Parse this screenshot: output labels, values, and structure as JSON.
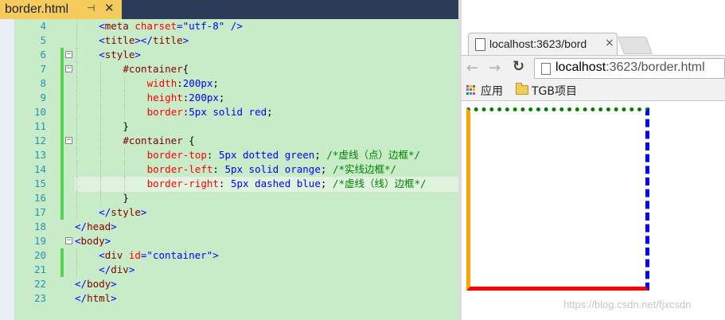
{
  "editor": {
    "tab_title": "border.html",
    "pin_glyph": "⊣",
    "close_glyph": "✕",
    "lines": [
      {
        "num": "4",
        "indent": 2,
        "changed": false,
        "fold": "",
        "tokens": [
          {
            "t": "<",
            "c": "tag"
          },
          {
            "t": "meta",
            "c": "name"
          },
          {
            "t": " charset",
            "c": "attr"
          },
          {
            "t": "=",
            "c": "tag"
          },
          {
            "t": "\"utf-8\"",
            "c": "val"
          },
          {
            "t": " />",
            "c": "tag"
          }
        ]
      },
      {
        "num": "5",
        "indent": 2,
        "changed": false,
        "fold": "",
        "tokens": [
          {
            "t": "<",
            "c": "tag"
          },
          {
            "t": "title",
            "c": "name"
          },
          {
            "t": "></",
            "c": "tag"
          },
          {
            "t": "title",
            "c": "name"
          },
          {
            "t": ">",
            "c": "tag"
          }
        ]
      },
      {
        "num": "6",
        "indent": 2,
        "changed": true,
        "fold": "−",
        "tokens": [
          {
            "t": "<",
            "c": "tag"
          },
          {
            "t": "style",
            "c": "name"
          },
          {
            "t": ">",
            "c": "tag"
          }
        ]
      },
      {
        "num": "7",
        "indent": 4,
        "changed": true,
        "fold": "−",
        "tokens": [
          {
            "t": "#container",
            "c": "sel"
          },
          {
            "t": "{",
            "c": "txt"
          }
        ]
      },
      {
        "num": "8",
        "indent": 6,
        "changed": true,
        "fold": "",
        "tokens": [
          {
            "t": "width",
            "c": "prop"
          },
          {
            "t": ":",
            "c": "txt"
          },
          {
            "t": "200px",
            "c": "val"
          },
          {
            "t": ";",
            "c": "txt"
          }
        ]
      },
      {
        "num": "9",
        "indent": 6,
        "changed": true,
        "fold": "",
        "tokens": [
          {
            "t": "height",
            "c": "prop"
          },
          {
            "t": ":",
            "c": "txt"
          },
          {
            "t": "200px",
            "c": "val"
          },
          {
            "t": ";",
            "c": "txt"
          }
        ]
      },
      {
        "num": "10",
        "indent": 6,
        "changed": true,
        "fold": "",
        "tokens": [
          {
            "t": "border",
            "c": "prop"
          },
          {
            "t": ":",
            "c": "txt"
          },
          {
            "t": "5px solid red",
            "c": "val"
          },
          {
            "t": ";",
            "c": "txt"
          }
        ]
      },
      {
        "num": "11",
        "indent": 4,
        "changed": true,
        "fold": "",
        "tokens": [
          {
            "t": "}",
            "c": "txt"
          }
        ]
      },
      {
        "num": "12",
        "indent": 4,
        "changed": true,
        "fold": "−",
        "tokens": [
          {
            "t": "#container",
            "c": "sel"
          },
          {
            "t": " {",
            "c": "txt"
          }
        ]
      },
      {
        "num": "13",
        "indent": 6,
        "changed": true,
        "fold": "",
        "tokens": [
          {
            "t": "border-top",
            "c": "prop"
          },
          {
            "t": ": ",
            "c": "txt"
          },
          {
            "t": "5px dotted green",
            "c": "val"
          },
          {
            "t": "; ",
            "c": "txt"
          },
          {
            "t": "/*虚线（点）边框*/",
            "c": "cmt"
          }
        ]
      },
      {
        "num": "14",
        "indent": 6,
        "changed": true,
        "fold": "",
        "tokens": [
          {
            "t": "border-left",
            "c": "prop"
          },
          {
            "t": ": ",
            "c": "txt"
          },
          {
            "t": "5px solid orange",
            "c": "val"
          },
          {
            "t": "; ",
            "c": "txt"
          },
          {
            "t": "/*实线边框*/",
            "c": "cmt"
          }
        ]
      },
      {
        "num": "15",
        "indent": 6,
        "changed": true,
        "fold": "",
        "highlight": true,
        "tokens": [
          {
            "t": "border-right",
            "c": "prop"
          },
          {
            "t": ": ",
            "c": "txt"
          },
          {
            "t": "5px dashed blue",
            "c": "val"
          },
          {
            "t": "; ",
            "c": "txt"
          },
          {
            "t": "/*虚线（线）边框*/",
            "c": "cmt"
          }
        ]
      },
      {
        "num": "16",
        "indent": 4,
        "changed": true,
        "fold": "",
        "tokens": [
          {
            "t": "}",
            "c": "txt"
          }
        ]
      },
      {
        "num": "17",
        "indent": 2,
        "changed": true,
        "fold": "",
        "tokens": [
          {
            "t": "</",
            "c": "tag"
          },
          {
            "t": "style",
            "c": "name"
          },
          {
            "t": ">",
            "c": "tag"
          }
        ]
      },
      {
        "num": "18",
        "indent": 0,
        "changed": false,
        "fold": "",
        "tokens": [
          {
            "t": "</",
            "c": "tag"
          },
          {
            "t": "head",
            "c": "name"
          },
          {
            "t": ">",
            "c": "tag"
          }
        ]
      },
      {
        "num": "19",
        "indent": 0,
        "changed": false,
        "fold": "−",
        "tokens": [
          {
            "t": "<",
            "c": "tag"
          },
          {
            "t": "body",
            "c": "name"
          },
          {
            "t": ">",
            "c": "tag"
          }
        ]
      },
      {
        "num": "20",
        "indent": 2,
        "changed": true,
        "fold": "",
        "tokens": [
          {
            "t": "<",
            "c": "tag"
          },
          {
            "t": "div",
            "c": "name"
          },
          {
            "t": " id",
            "c": "attr"
          },
          {
            "t": "=",
            "c": "tag"
          },
          {
            "t": "\"container\"",
            "c": "val"
          },
          {
            "t": ">",
            "c": "tag"
          }
        ]
      },
      {
        "num": "21",
        "indent": 2,
        "changed": true,
        "fold": "",
        "tokens": [
          {
            "t": "</",
            "c": "tag"
          },
          {
            "t": "div",
            "c": "name"
          },
          {
            "t": ">",
            "c": "tag"
          }
        ]
      },
      {
        "num": "22",
        "indent": 0,
        "changed": false,
        "fold": "",
        "tokens": [
          {
            "t": "</",
            "c": "tag"
          },
          {
            "t": "body",
            "c": "name"
          },
          {
            "t": ">",
            "c": "tag"
          }
        ]
      },
      {
        "num": "23",
        "indent": 0,
        "changed": false,
        "fold": "",
        "tokens": [
          {
            "t": "</",
            "c": "tag"
          },
          {
            "t": "html",
            "c": "name"
          },
          {
            "t": ">",
            "c": "tag"
          }
        ]
      }
    ]
  },
  "browser": {
    "tab_title": "localhost:3623/bord",
    "tab_close": "×",
    "back_icon": "back-arrow-icon",
    "forward_icon": "forward-arrow-icon",
    "reload_icon": "reload-icon",
    "url_host": "localhost",
    "url_rest": ":3623/border.html",
    "bookmarks": {
      "apps_label": "应用",
      "folder_label": "TGB项目"
    },
    "box_colors": {
      "top": "#008000",
      "left": "#ffa500",
      "right": "#0000ff",
      "bottom": "#ff0000"
    },
    "watermark": "https://blog.csdn.net/fjxcsdn"
  }
}
